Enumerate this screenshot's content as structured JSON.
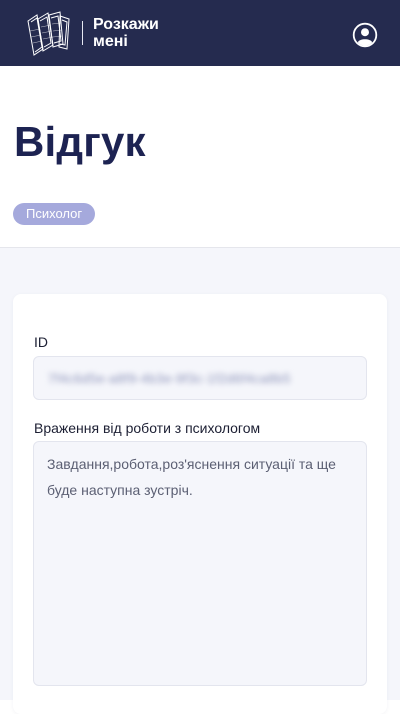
{
  "header": {
    "brand_line1": "Розкажи",
    "brand_line2": "мені",
    "logo_icon": "cards-logo-icon",
    "profile_icon": "user-circle-icon",
    "background_color": "#252b4f"
  },
  "page": {
    "title": "Відгук",
    "role_badge": "Психолог",
    "badge_color": "#a5a9dc"
  },
  "form": {
    "id_label": "ID",
    "id_value": "7f4c6d5e-a8f9-4b3e-9f3c-1f2d6f4ca8b5",
    "impression_label": "Враження від роботи з психологом",
    "impression_value": "Завдання,робота,роз'яснення ситуації та ще буде наступна зустріч."
  }
}
